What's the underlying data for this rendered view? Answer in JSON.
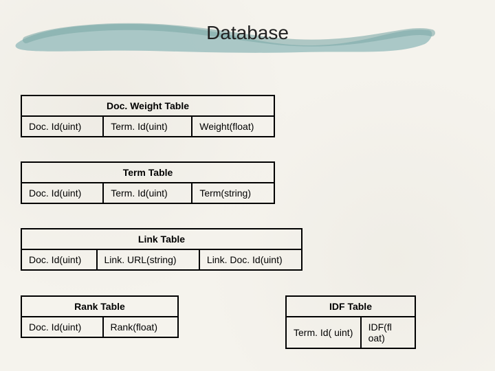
{
  "title": "Database",
  "tables": {
    "docweight": {
      "name": "Doc. Weight Table",
      "columns": [
        "Doc. Id(uint)",
        "Term. Id(uint)",
        "Weight(float)"
      ]
    },
    "term": {
      "name": "Term Table",
      "columns": [
        "Doc. Id(uint)",
        "Term. Id(uint)",
        "Term(string)"
      ]
    },
    "link": {
      "name": "Link Table",
      "columns": [
        "Doc. Id(uint)",
        "Link. URL(string)",
        "Link. Doc. Id(uint)"
      ]
    },
    "rank": {
      "name": "Rank Table",
      "columns": [
        "Doc. Id(uint)",
        "Rank(float)"
      ]
    },
    "idf": {
      "name": "IDF Table",
      "columns": [
        "Term. Id( uint)",
        "IDF(fl oat)"
      ]
    }
  }
}
